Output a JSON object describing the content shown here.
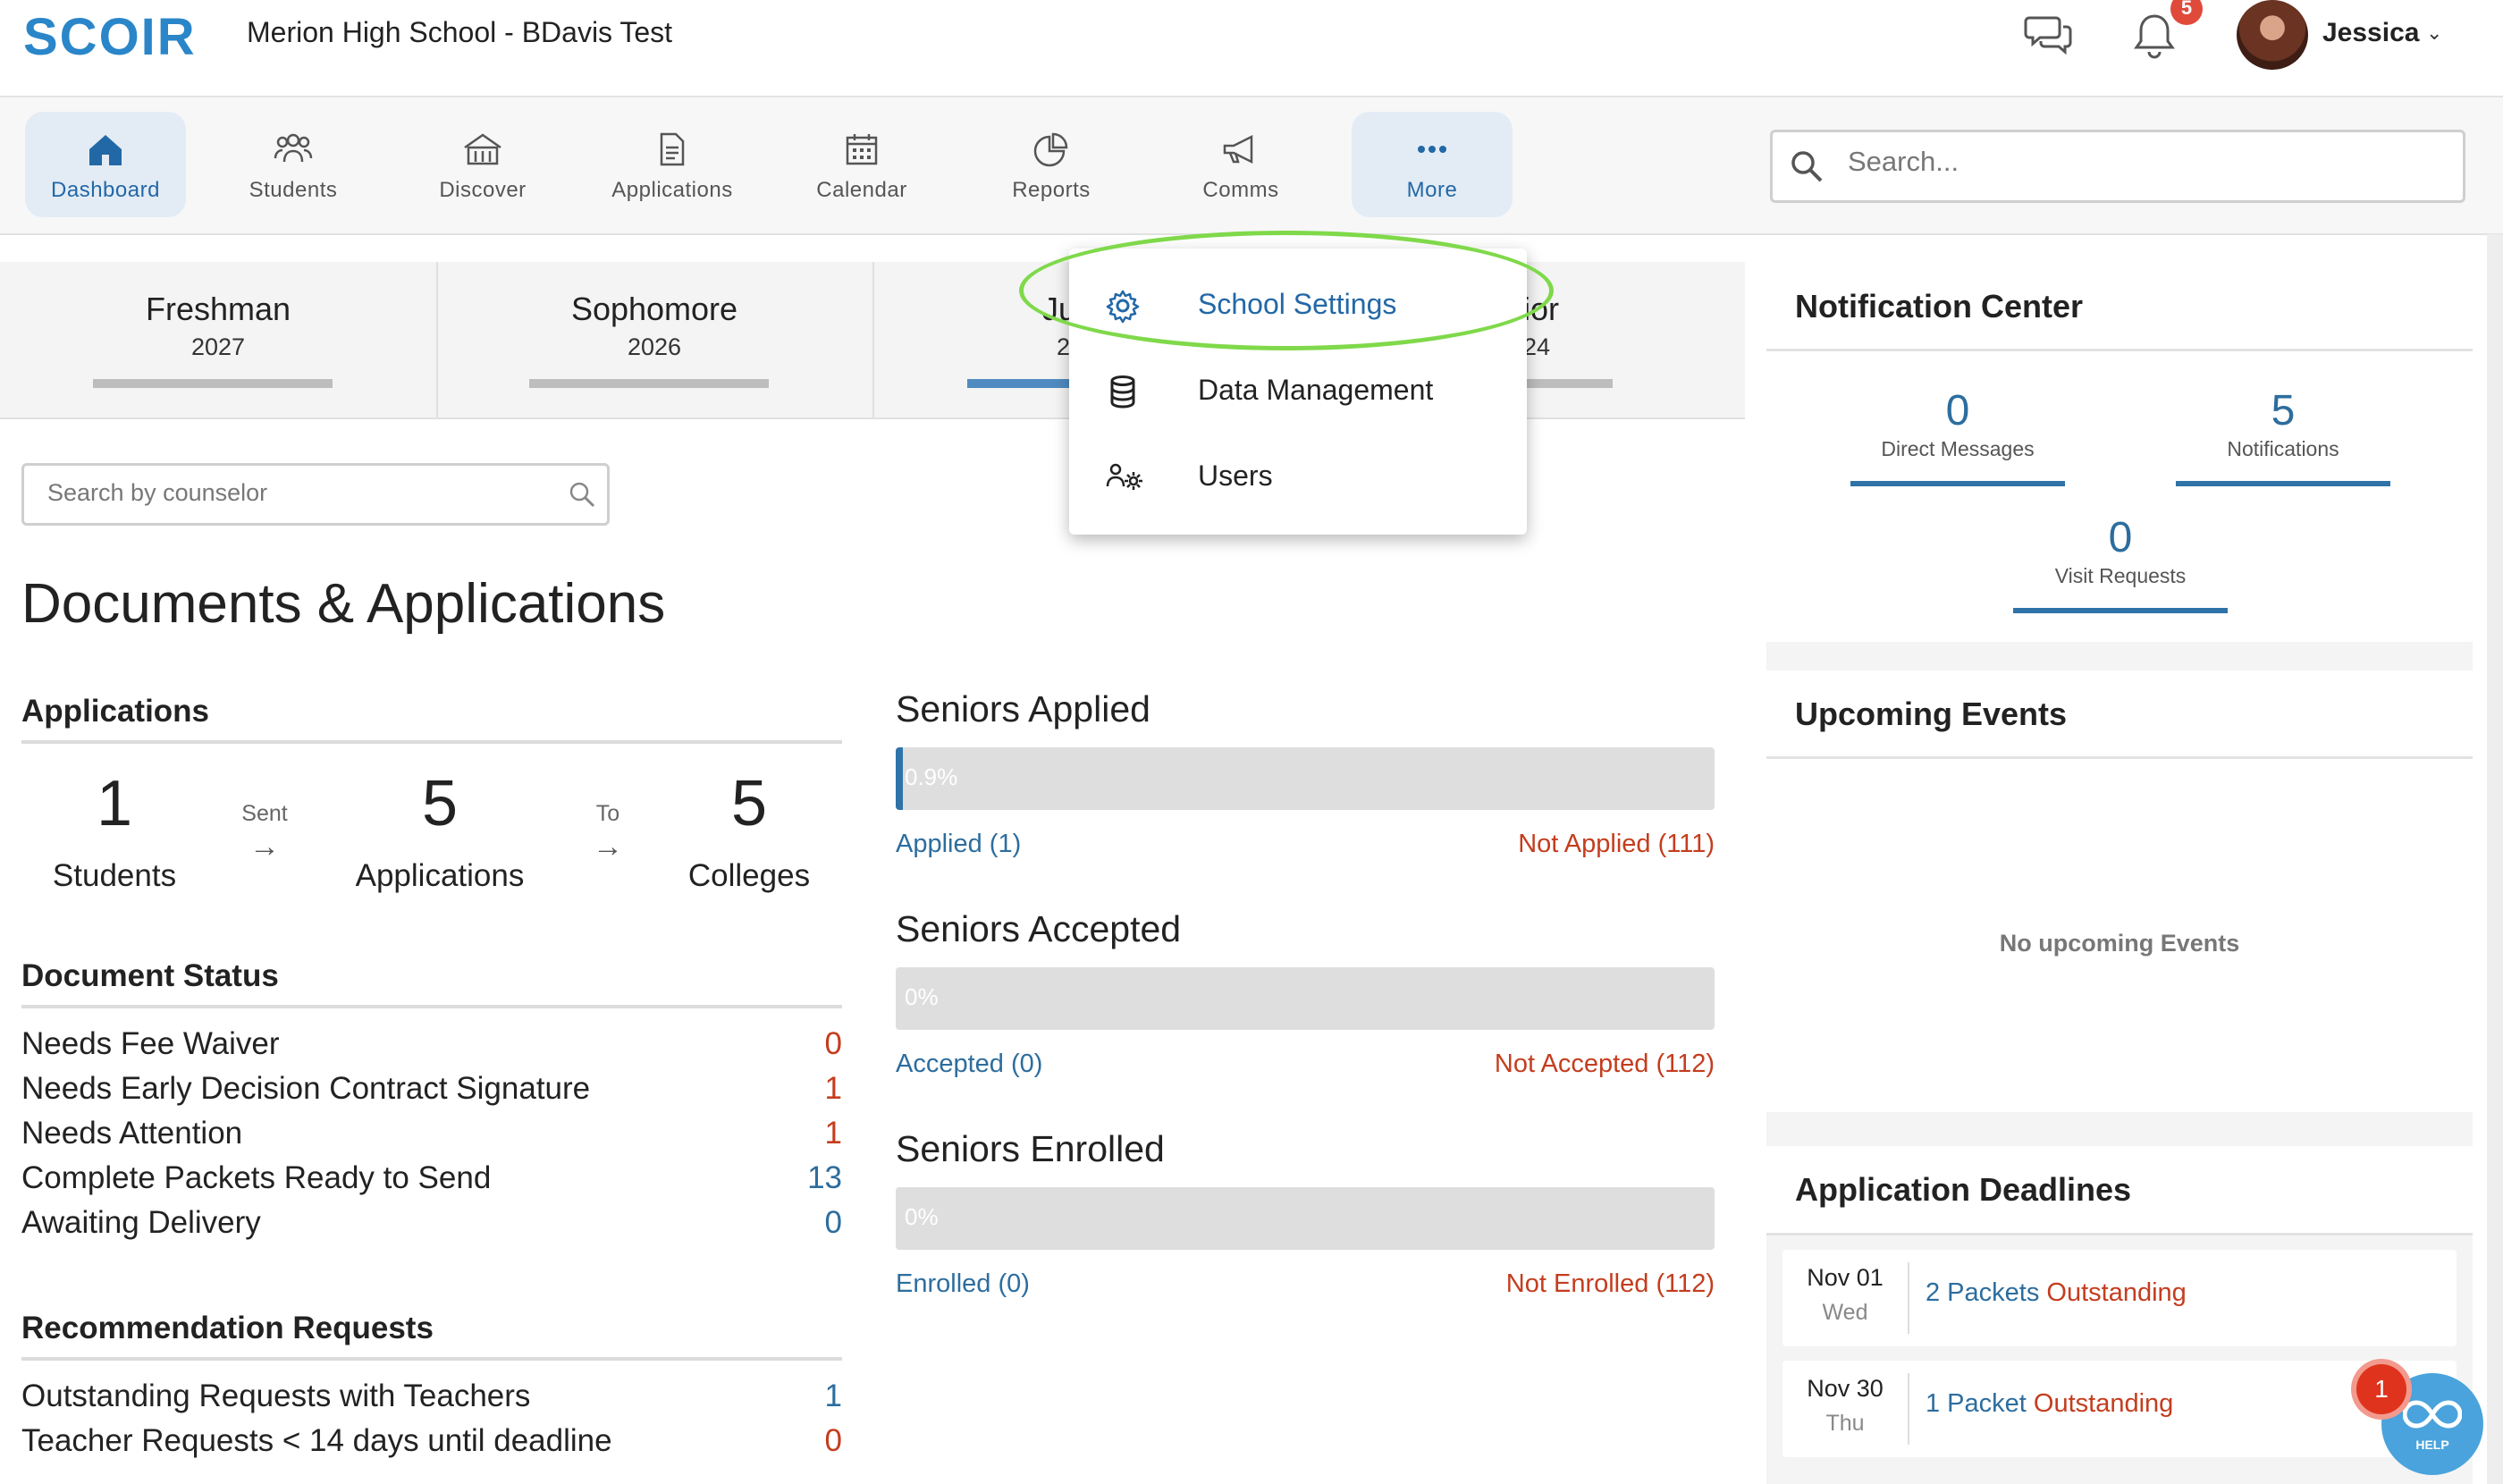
{
  "header": {
    "logo_text": "SCOIR",
    "school_title": "Merion High School - BDavis Test",
    "notification_badge": "5",
    "user_name": "Jessica"
  },
  "nav": {
    "items": [
      {
        "label": "Dashboard",
        "icon": "home-icon",
        "active": true
      },
      {
        "label": "Students",
        "icon": "students-icon"
      },
      {
        "label": "Discover",
        "icon": "discover-icon"
      },
      {
        "label": "Applications",
        "icon": "document-icon"
      },
      {
        "label": "Calendar",
        "icon": "calendar-icon"
      },
      {
        "label": "Reports",
        "icon": "reports-icon"
      },
      {
        "label": "Comms",
        "icon": "megaphone-icon"
      },
      {
        "label": "More",
        "icon": "more-dots-icon"
      }
    ],
    "search_placeholder": "Search..."
  },
  "class_tabs": [
    {
      "name": "Freshman",
      "year": "2027"
    },
    {
      "name": "Sophomore",
      "year": "2026"
    },
    {
      "name": "Ju",
      "year": "2"
    },
    {
      "name": "ior",
      "year": "24"
    }
  ],
  "more_menu": {
    "items": [
      {
        "label": "School Settings",
        "icon": "gear-icon"
      },
      {
        "label": "Data Management",
        "icon": "database-icon"
      },
      {
        "label": "Users",
        "icon": "users-gear-icon"
      }
    ]
  },
  "counselor_search_placeholder": "Search by counselor",
  "main": {
    "title": "Documents & Applications",
    "applications": {
      "heading": "Applications",
      "students_num": "1",
      "students_label": "Students",
      "sent_label": "Sent",
      "applications_num": "5",
      "applications_label": "Applications",
      "to_label": "To",
      "colleges_num": "5",
      "colleges_label": "Colleges"
    },
    "document_status": {
      "heading": "Document Status",
      "rows": [
        {
          "label": "Needs Fee Waiver",
          "value": "0",
          "color": "#c43d1e"
        },
        {
          "label": "Needs Early Decision Contract Signature",
          "value": "1",
          "color": "#c43d1e"
        },
        {
          "label": "Needs Attention",
          "value": "1",
          "color": "#c43d1e"
        },
        {
          "label": "Complete Packets Ready to Send",
          "value": "13",
          "color": "#2d6d9e"
        },
        {
          "label": "Awaiting Delivery",
          "value": "0",
          "color": "#2d6d9e"
        }
      ]
    },
    "recommendations": {
      "heading": "Recommendation Requests",
      "rows": [
        {
          "label": "Outstanding Requests with Teachers",
          "value": "1",
          "color": "#2d6d9e"
        },
        {
          "label": "Teacher Requests < 14 days until deadline",
          "value": "0",
          "color": "#c43d1e"
        }
      ]
    },
    "seniors": [
      {
        "title": "Seniors Applied",
        "percent": 0.009,
        "percent_label": "0.9%",
        "left": "Applied (1)",
        "right": "Not Applied (111)"
      },
      {
        "title": "Seniors Accepted",
        "percent": 0,
        "percent_label": "0%",
        "left": "Accepted (0)",
        "right": "Not Accepted (112)"
      },
      {
        "title": "Seniors Enrolled",
        "percent": 0,
        "percent_label": "0%",
        "left": "Enrolled (0)",
        "right": "Not Enrolled (112)"
      }
    ]
  },
  "notification_center": {
    "title": "Notification Center",
    "direct_messages_num": "0",
    "direct_messages_label": "Direct Messages",
    "notifications_num": "5",
    "notifications_label": "Notifications",
    "visit_requests_num": "0",
    "visit_requests_label": "Visit Requests"
  },
  "upcoming_events": {
    "title": "Upcoming Events",
    "empty_text": "No upcoming Events"
  },
  "application_deadlines": {
    "title": "Application Deadlines",
    "rows": [
      {
        "date": "Nov 01",
        "day": "Wed",
        "count_text": "2 Packets",
        "status_text": "Outstanding"
      },
      {
        "date": "Nov 30",
        "day": "Thu",
        "count_text": "1 Packet",
        "status_text": "Outstanding"
      }
    ]
  },
  "help": {
    "label": "HELP",
    "badge": "1"
  },
  "colors": {
    "accent": "#2368a6",
    "alert": "#c43d1e",
    "highlight": "#7fd94a"
  }
}
